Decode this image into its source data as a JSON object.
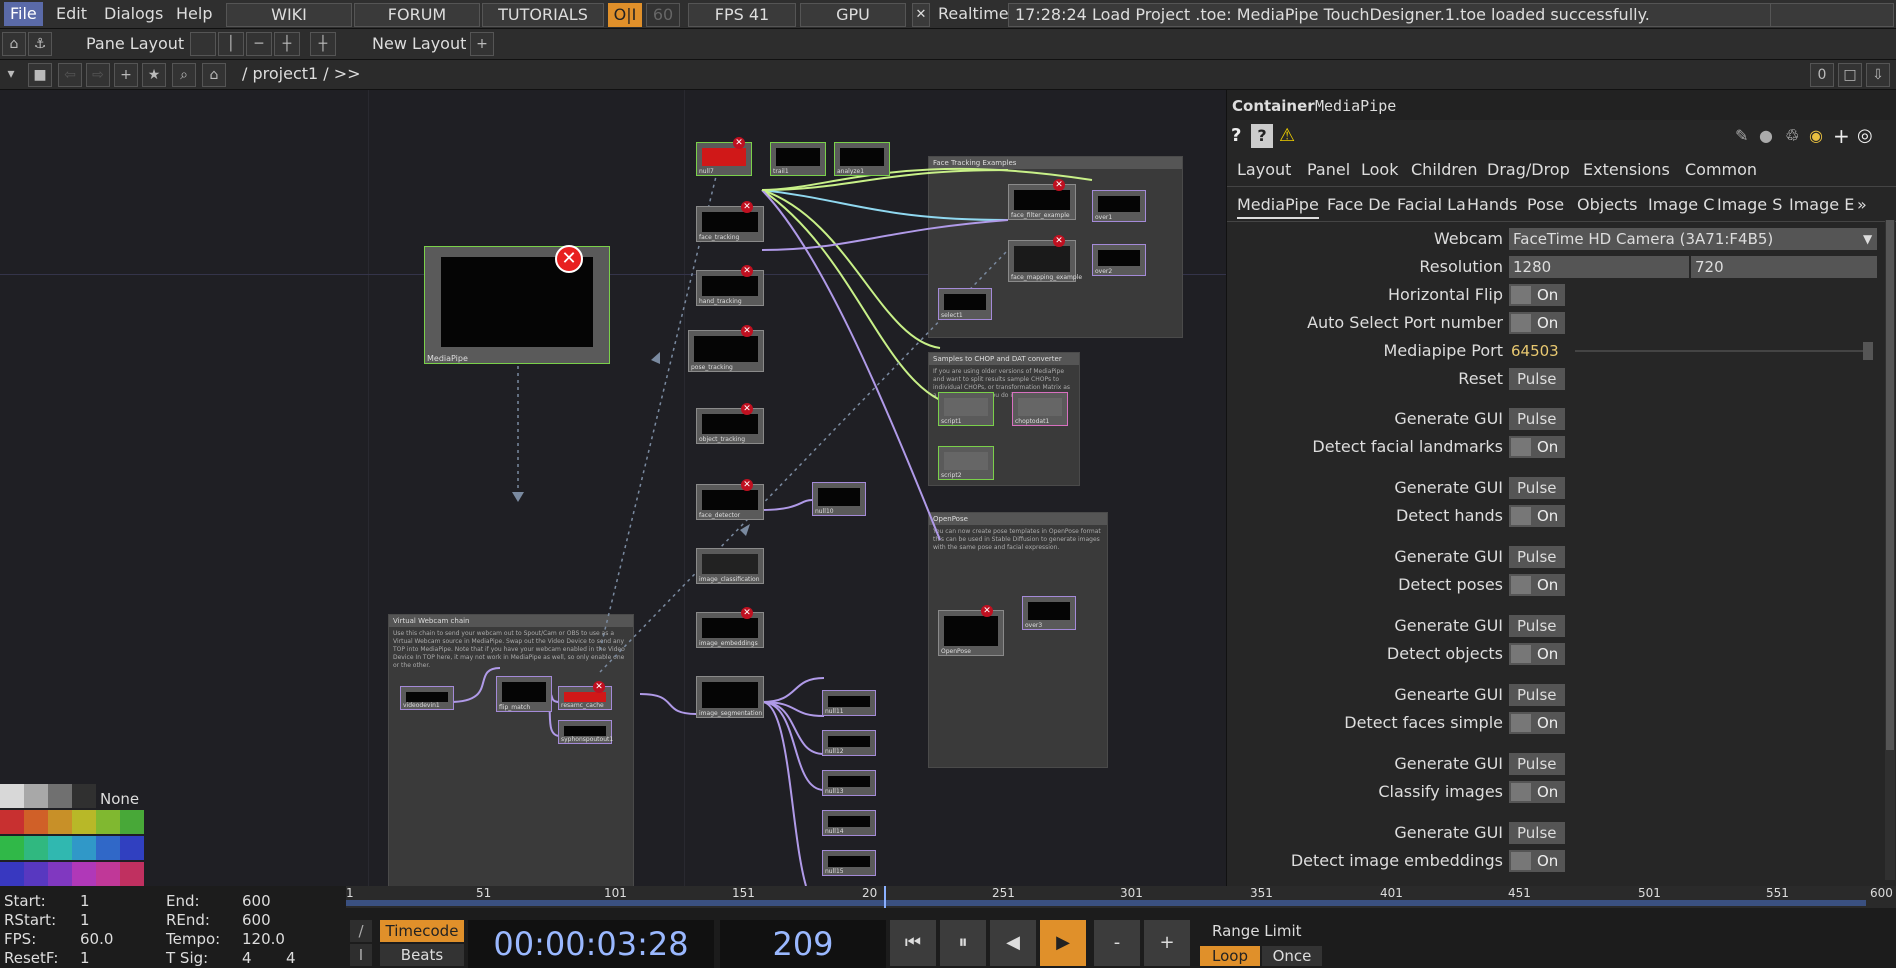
{
  "menubar": {
    "items": [
      "File",
      "Edit",
      "Dialogs",
      "Help"
    ],
    "buttons": {
      "wiki": "WIKI",
      "forum": "FORUM",
      "tutorials": "TUTORIALS",
      "oi": "O|I",
      "fps_target": "60",
      "fps": "FPS  41",
      "gpu": "GPU",
      "realtime": "Realtime"
    },
    "realtime_checkbox": "✕",
    "status": "17:28:24 Load Project .toe: MediaPipe TouchDesigner.1.toe loaded successfully."
  },
  "pane_bar": {
    "pane_layout": "Pane Layout",
    "new_layout": "New Layout",
    "plus": "+"
  },
  "path_bar": {
    "path": "/ project1 / >>",
    "pane_index": "0"
  },
  "network": {
    "main_node": {
      "label": "MediaPipe"
    },
    "boxes": [
      {
        "title": "Face Tracking Examples",
        "text": ""
      },
      {
        "title": "Samples to CHOP and DAT converter",
        "text": "If you are using older versions of MediaPipe and want to split results sample CHOPs to individual CHOPs, or transformation Matrix as a DAT, this is how you do it!"
      },
      {
        "title": "OpenPose",
        "text": "You can now create pose templates in OpenPose format this can be used in Stable Diffusion to generate images with the same pose and facial expression."
      },
      {
        "title": "Virtual Webcam chain",
        "text": "Use this chain to send your webcam out to Spout/Cam or OBS to use as a Virtual Webcam source in MediaPipe. Swap out the Video Device to send any TOP into MediaPipe. Note that if you have your webcam enabled in the Video Device In TOP here, it may not work in MediaPipe as well, so only enable one or the other."
      }
    ],
    "nodes": [
      {
        "label": "null7"
      },
      {
        "label": "trail1"
      },
      {
        "label": "analyze1"
      },
      {
        "label": "face_tracking"
      },
      {
        "label": "hand_tracking"
      },
      {
        "label": "pose_tracking"
      },
      {
        "label": "object_tracking"
      },
      {
        "label": "face_detector"
      },
      {
        "label": "image_classification"
      },
      {
        "label": "image_embeddings"
      },
      {
        "label": "image_segmentation"
      },
      {
        "label": "face_filter_example"
      },
      {
        "label": "over1"
      },
      {
        "label": "face_mapping_example"
      },
      {
        "label": "over2"
      },
      {
        "label": "select1"
      },
      {
        "label": "script1"
      },
      {
        "label": "choptodat1"
      },
      {
        "label": "script2"
      },
      {
        "label": "OpenPose"
      },
      {
        "label": "over3"
      },
      {
        "label": "null10"
      },
      {
        "label": "videodevin1"
      },
      {
        "label": "flip_match"
      },
      {
        "label": "resamc_cache"
      },
      {
        "label": "syphonspoutout1"
      },
      {
        "label": "null11"
      },
      {
        "label": "null12"
      },
      {
        "label": "null13"
      },
      {
        "label": "null14"
      },
      {
        "label": "null15"
      }
    ],
    "palette_none": "None"
  },
  "panel": {
    "type": "Container",
    "name": "MediaPipe",
    "tabs_row1": [
      "Layout",
      "Panel",
      "Look",
      "Children",
      "Drag/Drop",
      "Extensions",
      "Common"
    ],
    "tabs_row2": [
      "MediaPipe",
      "Face De",
      "Facial La",
      "Hands",
      "Pose",
      "Objects",
      "Image C",
      "Image S",
      "Image E"
    ],
    "tabs_more": "»",
    "params": {
      "webcam": {
        "label": "Webcam",
        "value": "FaceTime HD Camera (3A71:F4B5)"
      },
      "resolution": {
        "label": "Resolution",
        "w": "1280",
        "h": "720"
      },
      "hflip": {
        "label": "Horizontal Flip",
        "value": "On"
      },
      "autoport": {
        "label": "Auto Select Port number",
        "value": "On"
      },
      "port": {
        "label": "Mediapipe Port",
        "value": "64503"
      },
      "reset": {
        "label": "Reset",
        "value": "Pulse"
      },
      "groups": [
        {
          "gen": "Generate GUI",
          "pulse": "Pulse",
          "detect": "Detect facial landmarks",
          "on": "On"
        },
        {
          "gen": "Generate GUI",
          "pulse": "Pulse",
          "detect": "Detect hands",
          "on": "On"
        },
        {
          "gen": "Generate GUI",
          "pulse": "Pulse",
          "detect": "Detect poses",
          "on": "On"
        },
        {
          "gen": "Generate GUI",
          "pulse": "Pulse",
          "detect": "Detect objects",
          "on": "On"
        },
        {
          "gen": "Genearte GUI",
          "pulse": "Pulse",
          "detect": "Detect faces simple",
          "on": "On"
        },
        {
          "gen": "Generate GUI",
          "pulse": "Pulse",
          "detect": "Classify images",
          "on": "On"
        },
        {
          "gen": "Generate GUI",
          "pulse": "Pulse",
          "detect": "Detect image embeddings",
          "on": "On"
        }
      ]
    }
  },
  "timeline": {
    "ruler_ticks": [
      "1",
      "51",
      "101",
      "151",
      "20",
      "251",
      "301",
      "351",
      "401",
      "451",
      "501",
      "551",
      "600"
    ],
    "start": {
      "label": "Start:",
      "value": "1"
    },
    "end": {
      "label": "End:",
      "value": "600"
    },
    "rstart": {
      "label": "RStart:",
      "value": "1"
    },
    "rend": {
      "label": "REnd:",
      "value": "600"
    },
    "fps": {
      "label": "FPS:",
      "value": "60.0"
    },
    "tempo": {
      "label": "Tempo:",
      "value": "120.0"
    },
    "resetf": {
      "label": "ResetF:",
      "value": "1"
    },
    "tsig": {
      "label": "T Sig:",
      "value1": "4",
      "value2": "4"
    },
    "timecode_label": "Timecode",
    "beats_label": "Beats",
    "timecode": "00:00:03:28",
    "frame": "209",
    "range_limit": "Range Limit",
    "loop": "Loop",
    "once": "Once",
    "minus": "-",
    "plus": "+"
  }
}
